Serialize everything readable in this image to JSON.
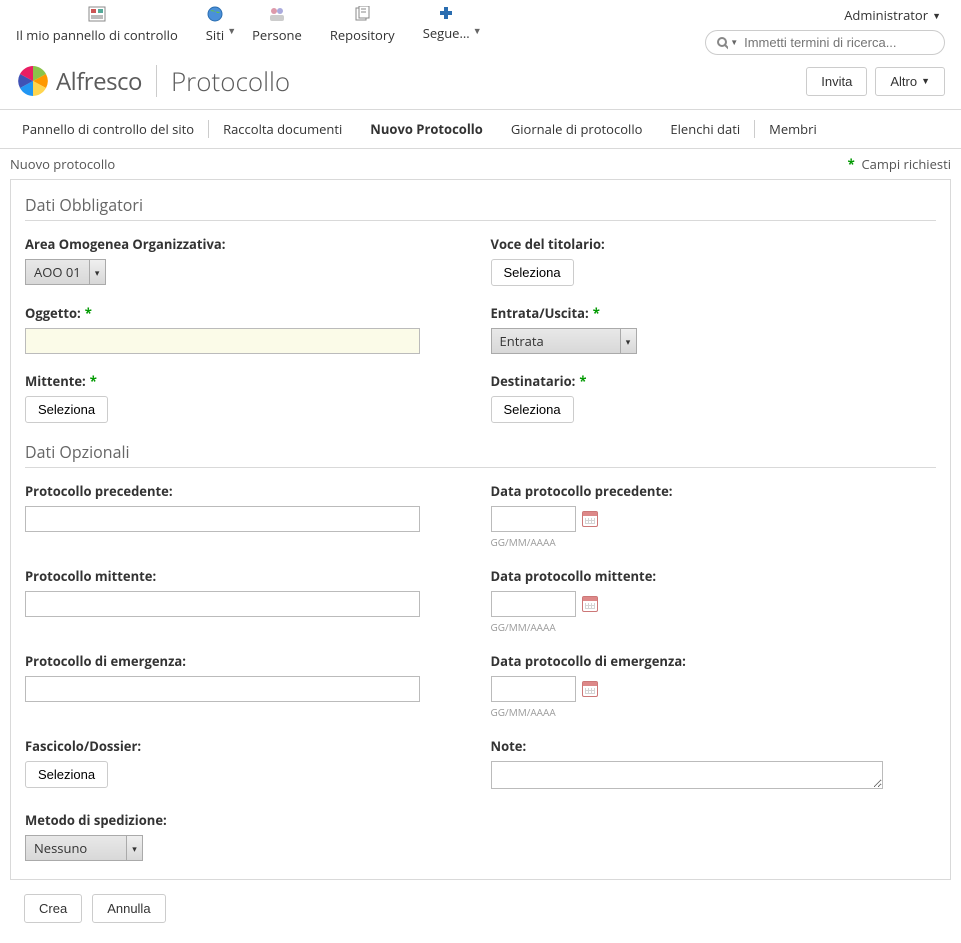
{
  "topnav": {
    "my_dashboard": "Il mio pannello di controllo",
    "sites": "Siti",
    "people": "Persone",
    "repository": "Repository",
    "follow": "Segue..."
  },
  "user": {
    "name": "Administrator"
  },
  "search": {
    "placeholder": "Immetti termini di ricerca..."
  },
  "brand": {
    "name": "Alfresco",
    "page": "Protocollo"
  },
  "brand_actions": {
    "invite": "Invita",
    "more": "Altro"
  },
  "sitenav": {
    "dashboard": "Pannello di controllo del sito",
    "doclib": "Raccolta documenti",
    "newproto": "Nuovo Protocollo",
    "journal": "Giornale di protocollo",
    "datalists": "Elenchi dati",
    "members": "Membri"
  },
  "page_title": "Nuovo protocollo",
  "required_note": "Campi richiesti",
  "sections": {
    "mandatory": "Dati Obbligatori",
    "optional": "Dati Opzionali"
  },
  "fields": {
    "aoo_label": "Area Omogenea Organizzativa:",
    "aoo_value": "AOO 01",
    "titolario_label": "Voce del titolario:",
    "oggetto_label": "Oggetto:",
    "inout_label": "Entrata/Uscita:",
    "inout_value": "Entrata",
    "mittente_label": "Mittente:",
    "destinatario_label": "Destinatario:",
    "proto_prec_label": "Protocollo precedente:",
    "data_proto_prec_label": "Data protocollo precedente:",
    "proto_mitt_label": "Protocollo mittente:",
    "data_proto_mitt_label": "Data protocollo mittente:",
    "proto_emerg_label": "Protocollo di emergenza:",
    "data_proto_emerg_label": "Data protocollo di emergenza:",
    "fascicolo_label": "Fascicolo/Dossier:",
    "note_label": "Note:",
    "metodo_label": "Metodo di spedizione:",
    "metodo_value": "Nessuno",
    "date_hint": "GG/MM/AAAA"
  },
  "buttons": {
    "seleziona": "Seleziona",
    "crea": "Crea",
    "annulla": "Annulla"
  }
}
